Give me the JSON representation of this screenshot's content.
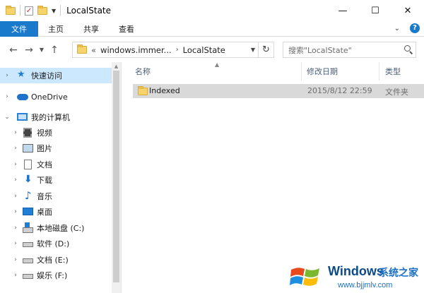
{
  "window": {
    "title": "LocalState",
    "controls": {
      "minimize": "—",
      "maximize": "☐",
      "close": "✕"
    }
  },
  "ribbon": {
    "tabs": [
      {
        "label": "文件"
      },
      {
        "label": "主页"
      },
      {
        "label": "共享"
      },
      {
        "label": "查看"
      }
    ],
    "help": "?"
  },
  "address": {
    "overflow": "«",
    "segments": [
      "windows.immer...",
      "LocalState"
    ],
    "search_placeholder": "搜索\"LocalState\""
  },
  "nav_pane": {
    "items": [
      {
        "label": "快速访问",
        "icon": "star-icon",
        "selected": true
      },
      {
        "label": "OneDrive",
        "icon": "cloud-icon"
      },
      {
        "label": "我的计算机",
        "icon": "computer-icon",
        "expanded": true
      },
      {
        "label": "视频",
        "icon": "video-icon"
      },
      {
        "label": "图片",
        "icon": "pictures-icon"
      },
      {
        "label": "文档",
        "icon": "documents-icon"
      },
      {
        "label": "下载",
        "icon": "download-icon"
      },
      {
        "label": "音乐",
        "icon": "music-icon"
      },
      {
        "label": "桌面",
        "icon": "desktop-icon"
      },
      {
        "label": "本地磁盘 (C:)",
        "icon": "system-drive-icon"
      },
      {
        "label": "软件 (D:)",
        "icon": "drive-icon"
      },
      {
        "label": "文档 (E:)",
        "icon": "drive-icon"
      },
      {
        "label": "娱乐 (F:)",
        "icon": "drive-icon"
      }
    ]
  },
  "content": {
    "columns": [
      "名称",
      "修改日期",
      "类型"
    ],
    "rows": [
      {
        "name": "Indexed",
        "modified": "2015/8/12 22:59",
        "type": "文件夹",
        "icon": "folder-icon"
      }
    ]
  },
  "watermark": {
    "brand": "Windows",
    "brand_suffix": "系统之家",
    "url": "www.bjjmlv.com",
    "colors": [
      "#e8491d",
      "#7cb82f",
      "#1c8fe0",
      "#fbbc09"
    ]
  }
}
